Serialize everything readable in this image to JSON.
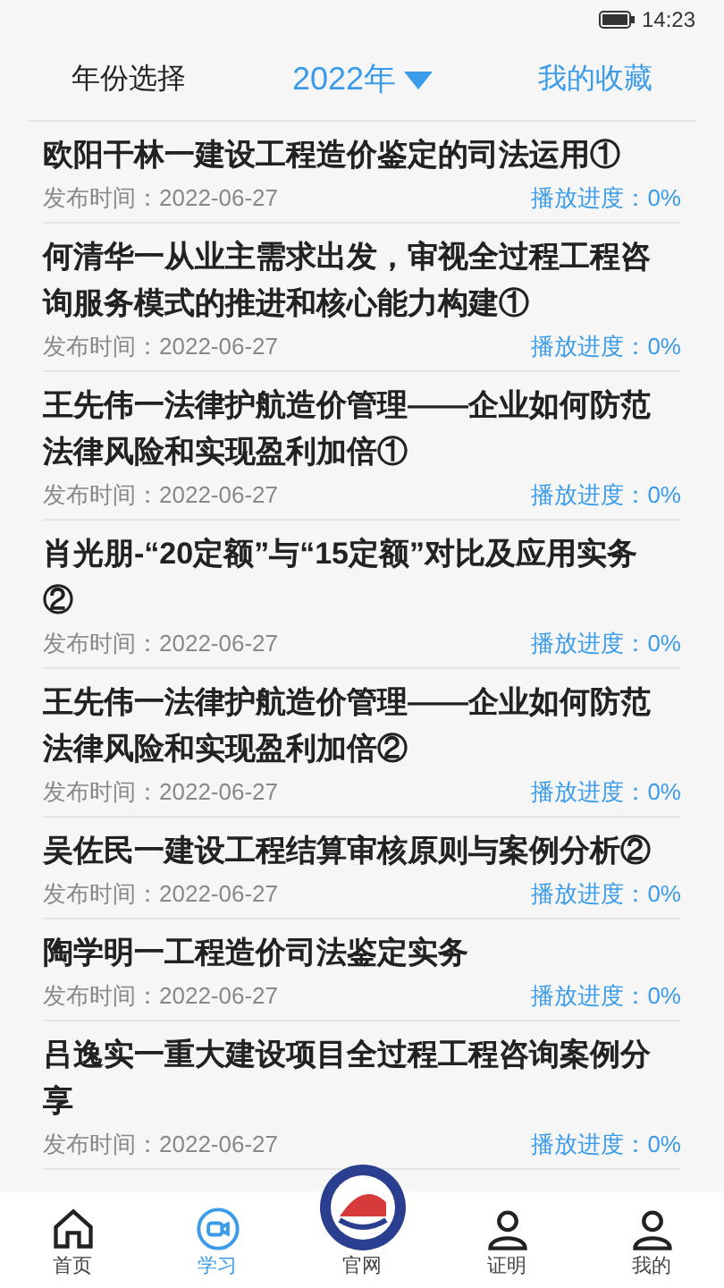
{
  "status_bar": {
    "time": "14:23"
  },
  "header": {
    "left": "年份选择",
    "year": "2022年",
    "right": "我的收藏"
  },
  "items": [
    {
      "title": "欧阳干林一建设工程造价鉴定的司法运用①",
      "date": "发布时间：2022-06-27",
      "progress": "播放进度：0%",
      "level": 0
    },
    {
      "title": "何清华一从业主需求出发，审视全过程工程咨询服务模式的推进和核心能力构建①",
      "date": "发布时间：2022-06-27",
      "progress": "播放进度：0%",
      "level": 0
    },
    {
      "title": "王先伟一法律护航造价管理——企业如何防范法律风险和实现盈利加倍①",
      "date": "发布时间：2022-06-27",
      "progress": "播放进度：0%",
      "level": 0
    },
    {
      "title": "肖光朋-“20定额”与“15定额”对比及应用实务②",
      "date": "发布时间：2022-06-27",
      "progress": "播放进度：0%",
      "level": 0
    },
    {
      "title": "王先伟一法律护航造价管理——企业如何防范法律风险和实现盈利加倍②",
      "date": "发布时间：2022-06-27",
      "progress": "播放进度：0%",
      "level": 0
    },
    {
      "title": "吴佐民一建设工程结算审核原则与案例分析②",
      "date": "发布时间：2022-06-27",
      "progress": "播放进度：0%",
      "level": 0
    },
    {
      "title": "陶学明一工程造价司法鉴定实务",
      "date": "发布时间：2022-06-27",
      "progress": "播放进度：0%",
      "level": 0
    },
    {
      "title": "吕逸实一重大建设项目全过程工程咨询案例分享",
      "date": "发布时间：2022-06-27",
      "progress": "播放进度：0%",
      "level": 0
    }
  ],
  "tabs": [
    {
      "kind": "home",
      "label": "首页",
      "selected": false
    },
    {
      "kind": "video",
      "label": "学习",
      "selected": true
    },
    {
      "kind": "logo",
      "label": "官网",
      "selected": false
    },
    {
      "kind": "person",
      "label": "证明",
      "selected": false
    },
    {
      "kind": "person",
      "label": "我的",
      "selected": false
    }
  ]
}
